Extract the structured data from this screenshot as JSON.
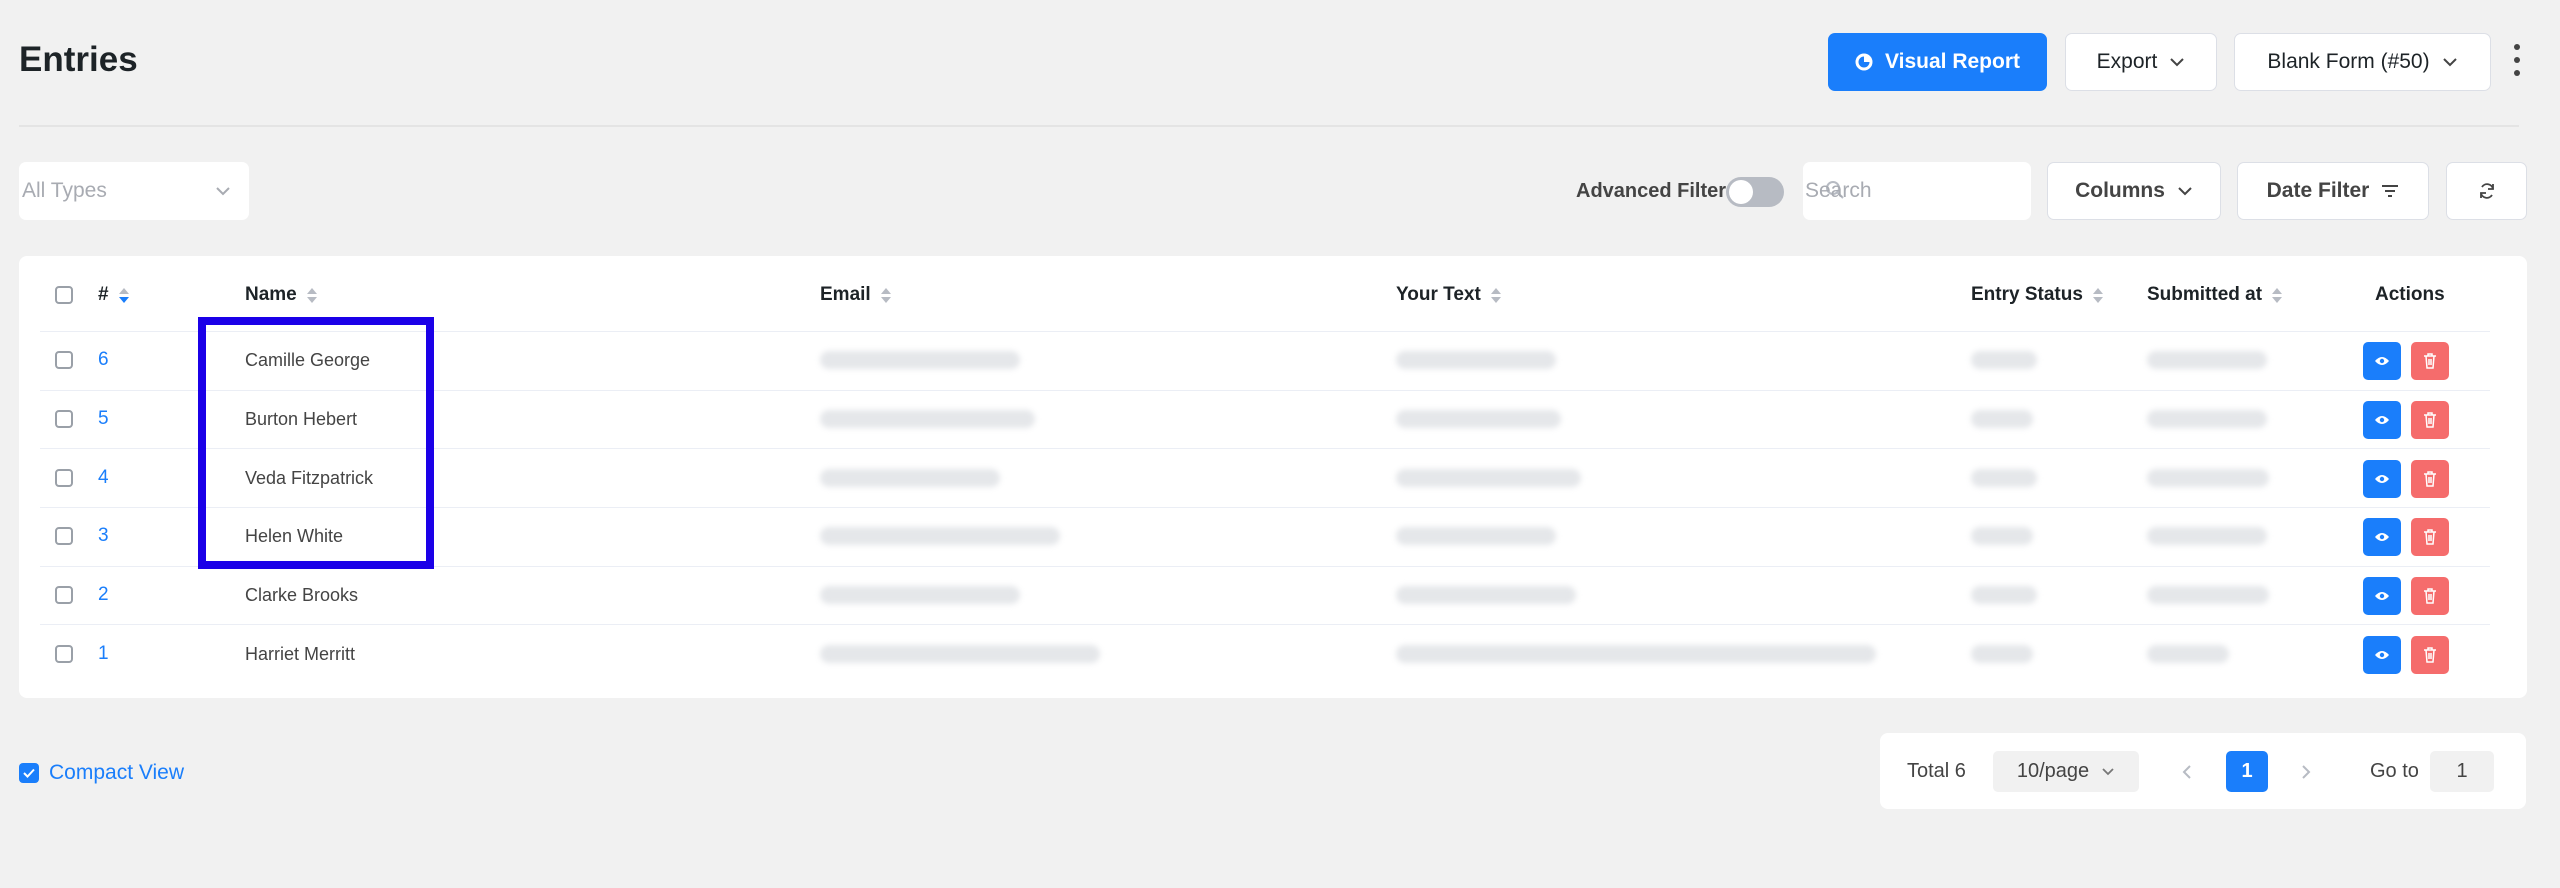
{
  "header": {
    "title": "Entries",
    "visual_report_label": "Visual Report",
    "export_label": "Export",
    "form_select_label": "Blank Form (#50)"
  },
  "filters": {
    "types_placeholder": "All Types",
    "advanced_filter_label": "Advanced Filter",
    "search_placeholder": "Search",
    "columns_label": "Columns",
    "date_filter_label": "Date Filter"
  },
  "table": {
    "columns": [
      "#",
      "Name",
      "Email",
      "Your Text",
      "Entry Status",
      "Submitted at",
      "Actions"
    ],
    "rows": [
      {
        "id": "6",
        "name": "Camille George"
      },
      {
        "id": "5",
        "name": "Burton Hebert"
      },
      {
        "id": "4",
        "name": "Veda Fitzpatrick"
      },
      {
        "id": "3",
        "name": "Helen White"
      },
      {
        "id": "2",
        "name": "Clarke Brooks"
      },
      {
        "id": "1",
        "name": "Harriet Merritt"
      }
    ]
  },
  "footer": {
    "compact_view_label": "Compact View",
    "total_label": "Total 6",
    "page_size_label": "10/page",
    "current_page": "1",
    "goto_label": "Go to",
    "goto_value": "1"
  },
  "colors": {
    "primary": "#1a7efb",
    "danger": "#f56c6c",
    "highlight_box": "#1b00e8"
  }
}
